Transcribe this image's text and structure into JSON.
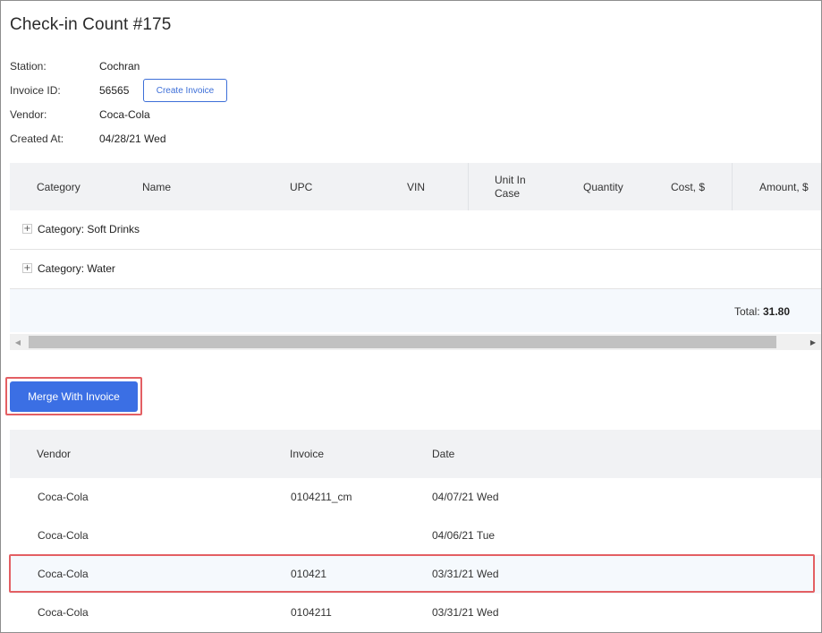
{
  "page": {
    "title": "Check-in Count #175"
  },
  "meta": {
    "station_label": "Station:",
    "station_value": "Cochran",
    "invoice_label": "Invoice ID:",
    "invoice_value": "56565",
    "create_invoice_label": "Create Invoice",
    "vendor_label": "Vendor:",
    "vendor_value": "Coca-Cola",
    "created_label": "Created At:",
    "created_value": "04/28/21 Wed"
  },
  "items_table": {
    "columns": [
      "Category",
      "Name",
      "UPC",
      "VIN",
      "Unit In Case",
      "Quantity",
      "Cost, $",
      "Amount, $"
    ],
    "unit_in_case_line1": "Unit In",
    "unit_in_case_line2": "Case",
    "groups": [
      {
        "label": "Category: Soft Drinks",
        "expander": "+"
      },
      {
        "label": "Category: Water",
        "expander": "+"
      }
    ],
    "total_label": "Total:",
    "total_value": "31.80"
  },
  "merge_button_label": "Merge With Invoice",
  "invoice_list": {
    "columns": [
      "Vendor",
      "Invoice",
      "Date"
    ],
    "rows": [
      {
        "vendor": "Coca-Cola",
        "invoice": "0104211_cm",
        "date": "04/07/21 Wed"
      },
      {
        "vendor": "Coca-Cola",
        "invoice": "",
        "date": "04/06/21 Tue"
      },
      {
        "vendor": "Coca-Cola",
        "invoice": "010421",
        "date": "03/31/21 Wed"
      },
      {
        "vendor": "Coca-Cola",
        "invoice": "0104211",
        "date": "03/31/21 Wed"
      }
    ],
    "selected_row": 2
  },
  "colors": {
    "accent": "#3b6fe4",
    "highlight": "#e35f63",
    "header_bg": "#f1f2f4",
    "selected_bg": "#f5f9fd"
  },
  "icons": {
    "expander": "plus-icon",
    "scroll_left": "arrow-left-icon",
    "scroll_right": "arrow-right-icon"
  }
}
